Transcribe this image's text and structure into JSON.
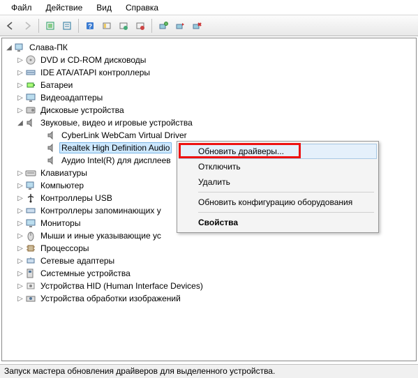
{
  "menu": {
    "file": "Файл",
    "action": "Действие",
    "view": "Вид",
    "help": "Справка"
  },
  "root": {
    "label": "Слава-ПК"
  },
  "categories": [
    {
      "id": "dvd",
      "label": "DVD и CD-ROM дисководы",
      "expandable": true
    },
    {
      "id": "ide",
      "label": "IDE ATA/ATAPI контроллеры",
      "expandable": true
    },
    {
      "id": "bat",
      "label": "Батареи",
      "expandable": true
    },
    {
      "id": "vid",
      "label": "Видеоадаптеры",
      "expandable": true
    },
    {
      "id": "disk",
      "label": "Дисковые устройства",
      "expandable": true
    },
    {
      "id": "audio",
      "label": "Звуковые, видео и игровые устройства",
      "expandable": true,
      "expanded": true
    },
    {
      "id": "kbd",
      "label": "Клавиатуры",
      "expandable": true
    },
    {
      "id": "comp",
      "label": "Компьютер",
      "expandable": true
    },
    {
      "id": "usb",
      "label": "Контроллеры USB",
      "expandable": true
    },
    {
      "id": "stor",
      "label": "Контроллеры запоминающих у",
      "expandable": true
    },
    {
      "id": "mon",
      "label": "Мониторы",
      "expandable": true
    },
    {
      "id": "mouse",
      "label": "Мыши и иные указывающие ус",
      "expandable": true
    },
    {
      "id": "proc",
      "label": "Процессоры",
      "expandable": true
    },
    {
      "id": "net",
      "label": "Сетевые адаптеры",
      "expandable": true
    },
    {
      "id": "sys",
      "label": "Системные устройства",
      "expandable": true
    },
    {
      "id": "hid",
      "label": "Устройства HID (Human Interface Devices)",
      "expandable": true
    },
    {
      "id": "img",
      "label": "Устройства обработки изображений",
      "expandable": true
    }
  ],
  "audio_children": [
    {
      "id": "cyberlink",
      "label": "CyberLink WebCam Virtual Driver"
    },
    {
      "id": "realtek",
      "label": "Realtek High Definition Audio",
      "selected": true
    },
    {
      "id": "intelr",
      "label": "Аудио Intel(R) для дисплеев"
    }
  ],
  "context_menu": {
    "update": "Обновить драйверы...",
    "disable": "Отключить",
    "delete": "Удалить",
    "refresh": "Обновить конфигурацию оборудования",
    "props": "Свойства"
  },
  "status": "Запуск мастера обновления драйверов для выделенного устройства."
}
